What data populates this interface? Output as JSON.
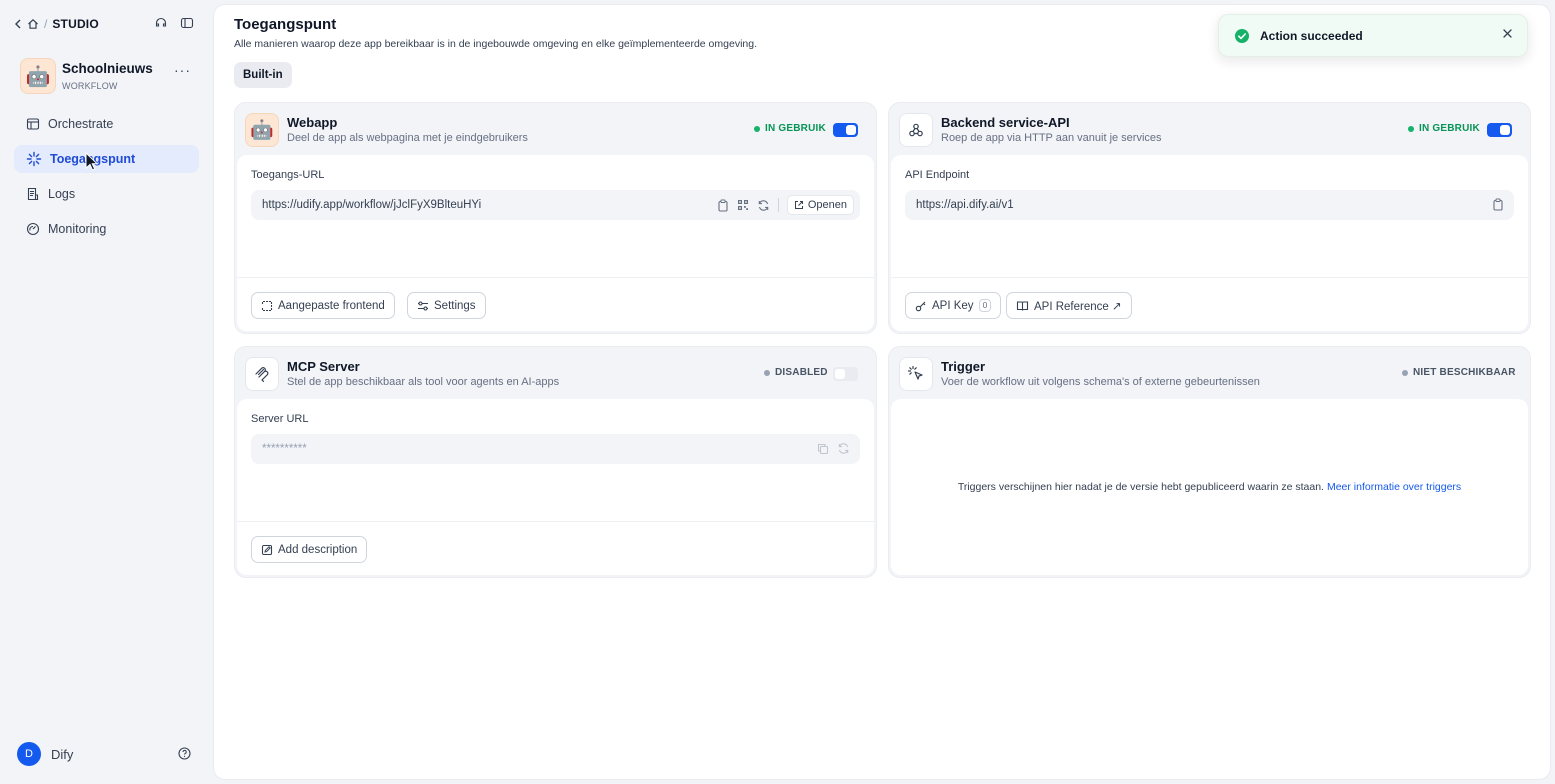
{
  "breadcrumb": {
    "section": "STUDIO"
  },
  "app": {
    "name": "Schoolnieuws",
    "type": "WORKFLOW",
    "more": "···"
  },
  "nav": [
    {
      "label": "Orchestrate",
      "icon": "layout-icon",
      "active": false
    },
    {
      "label": "Toegangspunt",
      "icon": "sparkle-icon",
      "active": true
    },
    {
      "label": "Logs",
      "icon": "file-list-icon",
      "active": false
    },
    {
      "label": "Monitoring",
      "icon": "gauge-icon",
      "active": false
    }
  ],
  "user": {
    "initial": "D",
    "name": "Dify"
  },
  "page": {
    "title": "Toegangspunt",
    "subtitle": "Alle manieren waarop deze app bereikbaar is in de ingebouwde omgeving en elke geïmplementeerde omgeving.",
    "tab": "Built-in"
  },
  "webapp": {
    "title": "Webapp",
    "desc": "Deel de app als webpagina met je eindgebruikers",
    "status": "IN GEBRUIK",
    "enabled": true,
    "field_label": "Toegangs-URL",
    "url": "https://udify.app/workflow/jJclFyX9BlteuHYi",
    "open_label": "Openen",
    "btn_frontend": "Aangepaste frontend",
    "btn_settings": "Settings"
  },
  "api": {
    "title": "Backend service-API",
    "desc": "Roep de app via HTTP aan vanuit je services",
    "status": "IN GEBRUIK",
    "enabled": true,
    "field_label": "API Endpoint",
    "url": "https://api.dify.ai/v1",
    "btn_key": "API Key",
    "key_count": "0",
    "btn_ref": "API Reference ↗"
  },
  "mcp": {
    "title": "MCP Server",
    "desc": "Stel de app beschikbaar als tool voor agents en AI-apps",
    "status": "DISABLED",
    "enabled": false,
    "field_label": "Server URL",
    "url": "**********",
    "btn_desc": "Add description"
  },
  "trigger": {
    "title": "Trigger",
    "desc": "Voer de workflow uit volgens schema's of externe gebeurtenissen",
    "status": "NIET BESCHIKBAAR",
    "message": "Triggers verschijnen hier nadat je de versie hebt gepubliceerd waarin ze staan.",
    "link": "Meer informatie over triggers"
  },
  "toast": {
    "message": "Action succeeded"
  },
  "colors": {
    "accent": "#155aef",
    "success": "#17b26a",
    "muted": "#98a2b3"
  }
}
